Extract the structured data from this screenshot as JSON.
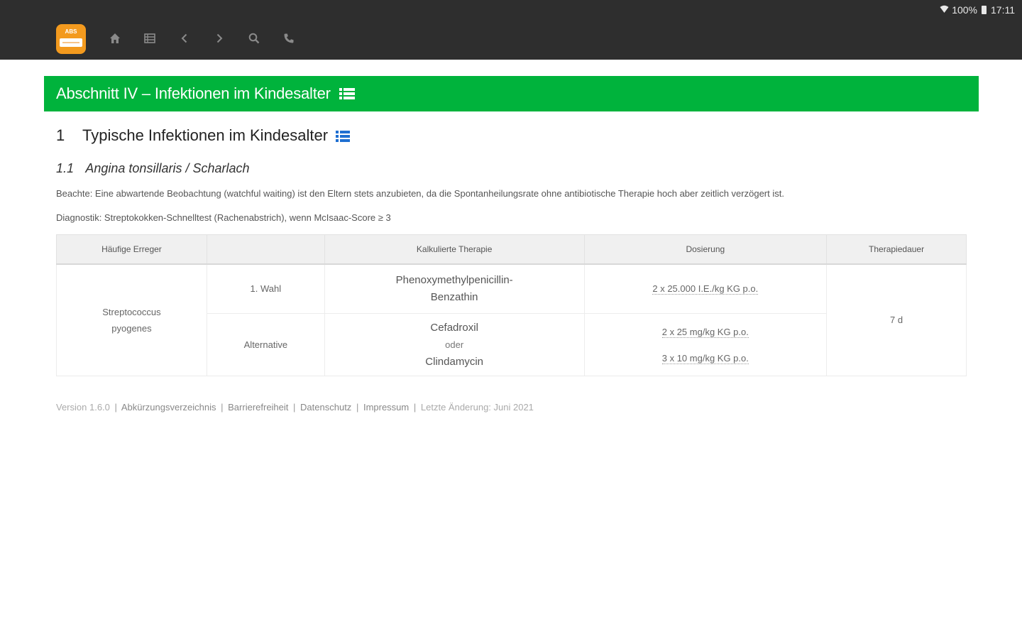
{
  "status": {
    "battery": "100%",
    "time": "17:11"
  },
  "app": {
    "logo_text": "ABS"
  },
  "nav": {
    "icons": [
      "home-icon",
      "list-icon",
      "chevron-left-icon",
      "chevron-right-icon",
      "search-icon",
      "phone-icon"
    ]
  },
  "section": {
    "title": "Abschnitt IV – Infektionen im Kindesalter"
  },
  "heading1": {
    "number": "1",
    "title": "Typische Infektionen im Kindesalter"
  },
  "heading2": {
    "number": "1.1",
    "title": "Angina tonsillaris / Scharlach"
  },
  "notes": {
    "beachte": "Beachte: Eine abwartende Beobachtung (watchful waiting) ist den Eltern stets anzubieten, da die Spontanheilungsrate ohne antibiotische Therapie hoch aber zeitlich verzögert ist.",
    "diagnostik": "Diagnostik: Streptokokken-Schnelltest (Rachenabstrich), wenn McIsaac-Score ≥ 3"
  },
  "table": {
    "headers": [
      "Häufige Erreger",
      "",
      "Kalkulierte Therapie",
      "Dosierung",
      "Therapiedauer"
    ],
    "pathogen": "Streptococcus pyogenes",
    "duration": "7 d",
    "rows": [
      {
        "choice": "1. Wahl",
        "therapy_line1": "Phenoxymethylpenicillin-",
        "therapy_line2": "Benzathin",
        "dose": "2 x 25.000 I.E./kg KG p.o."
      },
      {
        "choice": "Alternative",
        "therapy_line1": "Cefadroxil",
        "connector": "oder",
        "therapy_line2": "Clindamycin",
        "dose1": "2 x 25 mg/kg KG p.o.",
        "dose2": "3 x 10 mg/kg KG p.o."
      }
    ]
  },
  "footer": {
    "version": "Version 1.6.0",
    "links": [
      "Abkürzungsverzeichnis",
      "Barrierefreiheit",
      "Datenschutz",
      "Impressum"
    ],
    "last_change": "Letzte Änderung: Juni 2021"
  },
  "colors": {
    "topbar": "#2e2e2e",
    "banner": "#00b33c",
    "accent_blue": "#1f6fd1",
    "logo": "#f39a1e"
  }
}
